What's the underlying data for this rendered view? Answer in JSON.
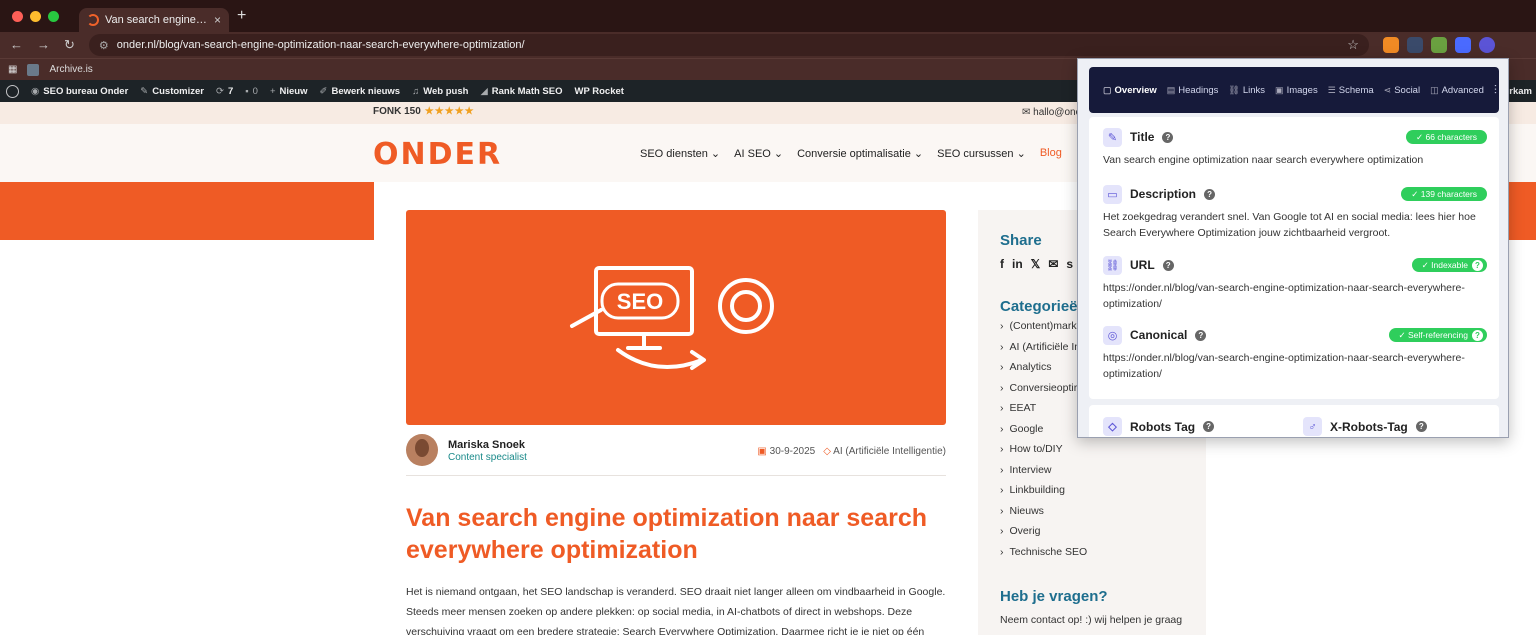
{
  "browser": {
    "tab_title": "Van search engine optimizatio",
    "url": "onder.nl/blog/van-search-engine-optimization-naar-search-everywhere-optimization/",
    "bookmark": "Archive.is"
  },
  "adminbar": {
    "items": [
      "SEO bureau Onder",
      "Customizer",
      "7",
      "0",
      "Nieuw",
      "Bewerk nieuws",
      "Web push",
      "Rank Math SEO",
      "WP Rocket"
    ],
    "right_fragment": "terkam"
  },
  "site": {
    "fonk": "FONK 150",
    "stars": "★★★★★",
    "mail": "hallo@onc",
    "logo": "ONDER",
    "nav": [
      "SEO diensten ⌄",
      "AI SEO ⌄",
      "Conversie optimalisatie ⌄",
      "SEO cursussen ⌄",
      "Blog"
    ],
    "hero_text": "SEO",
    "author_name": "Mariska Snoek",
    "author_role": "Content specialist",
    "date": "30-9-2025",
    "category": "AI (Artificiële Intelligentie)",
    "title": "Van search engine optimization naar search everywhere optimization",
    "paragraph": [
      "Het is niemand ontgaan, het SEO landschap is veranderd. SEO draait niet langer alleen om vindbaarheid in Google.",
      "Steeds meer mensen zoeken op andere plekken: op social media, in AI-chatbots of direct in webshops. Deze",
      "verschuiving vraagt om een bredere strategie: Search Everywhere Optimization. Daarmee richt je je niet op één"
    ]
  },
  "sidebar": {
    "share_title": "Share",
    "share_icons": [
      "f",
      "in",
      "𝕏",
      "✉",
      "s"
    ],
    "cat_title": "Categorieë",
    "categories": [
      "(Content)mark",
      "AI (Artificiële In",
      "Analytics",
      "Conversieoptir",
      "EEAT",
      "Google",
      "How to/DIY",
      "Interview",
      "Linkbuilding",
      "Nieuws",
      "Overig",
      "Technische SEO"
    ],
    "q_title": "Heb je vragen?",
    "q_text": "Neem contact op! :) wij helpen je graag"
  },
  "popup": {
    "tabs": [
      {
        "icon": "▢",
        "label": "Overview"
      },
      {
        "icon": "▤",
        "label": "Headings"
      },
      {
        "icon": "⛓",
        "label": "Links"
      },
      {
        "icon": "▣",
        "label": "Images"
      },
      {
        "icon": "☰",
        "label": "Schema"
      },
      {
        "icon": "⋖",
        "label": "Social"
      },
      {
        "icon": "◫",
        "label": "Advanced"
      }
    ],
    "title_label": "Title",
    "title_badge": "✓ 66 characters",
    "title_value": "Van search engine optimization naar search everywhere optimization",
    "desc_label": "Description",
    "desc_badge": "✓ 139 characters",
    "desc_value": "Het zoekgedrag verandert snel. Van Google tot AI en social media: lees hier hoe Search Everywhere Optimization jouw zichtbaarheid vergroot.",
    "url_label": "URL",
    "url_badge": "✓ Indexable",
    "url_value": "https://onder.nl/blog/van-search-engine-optimization-naar-search-everywhere-optimization/",
    "canon_label": "Canonical",
    "canon_badge": "✓ Self-referencing",
    "canon_value": "https://onder.nl/blog/van-search-engine-optimization-naar-search-everywhere-optimization/",
    "robots_label": "Robots Tag",
    "xrobots_label": "X-Robots-Tag"
  },
  "colors": {
    "brand_orange": "#ef5b25",
    "badge_green": "#2fce5c",
    "popup_nav": "#161a3a",
    "accent_teal": "#1e6e8e"
  }
}
